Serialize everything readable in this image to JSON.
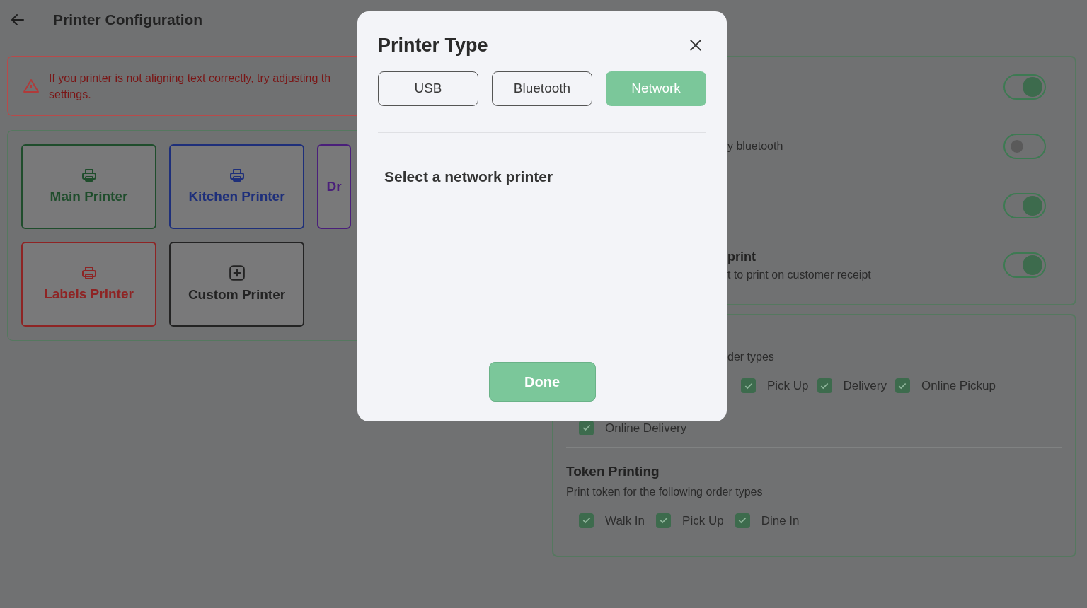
{
  "header": {
    "title": "Printer Configuration"
  },
  "alert": {
    "text": "If you printer is not aligning text correctly, try adjusting th",
    "text_2": "settings."
  },
  "printers": [
    {
      "label": "Main Printer",
      "kind": "printer",
      "color": "#1f4d2c"
    },
    {
      "label": "Kitchen Printer",
      "kind": "printer",
      "color": "#1e2f7a"
    },
    {
      "label": "Dr",
      "kind": "partial",
      "color": "#4a1f7a"
    },
    {
      "label": "Labels Printer",
      "kind": "printer",
      "color": "#8e2424"
    },
    {
      "label": "Custom Printer",
      "kind": "add",
      "color": "#232323"
    }
  ],
  "settings": [
    {
      "on": true
    },
    {
      "subtitle": "y bluetooth",
      "on": false
    },
    {
      "on": true
    },
    {
      "title": "print",
      "subtitle": "t to print on customer receipt",
      "on": true
    }
  ],
  "order_printing": {
    "subtitle": "der types",
    "options": [
      {
        "label": "Pick Up",
        "checked": true
      },
      {
        "label": "Delivery",
        "checked": true
      },
      {
        "label": "Online Pickup",
        "checked": true
      },
      {
        "label": "Online Delivery",
        "checked": true
      }
    ]
  },
  "token_printing": {
    "title": "Token Printing",
    "subtitle": "Print token for the following order types",
    "options": [
      {
        "label": "Walk In",
        "checked": true
      },
      {
        "label": "Pick Up",
        "checked": true
      },
      {
        "label": "Dine In",
        "checked": true
      }
    ]
  },
  "dialog": {
    "title": "Printer Type",
    "tabs": [
      {
        "label": "USB",
        "selected": false
      },
      {
        "label": "Bluetooth",
        "selected": false
      },
      {
        "label": "Network",
        "selected": true
      }
    ],
    "prompt": "Select a network printer",
    "done": "Done"
  }
}
